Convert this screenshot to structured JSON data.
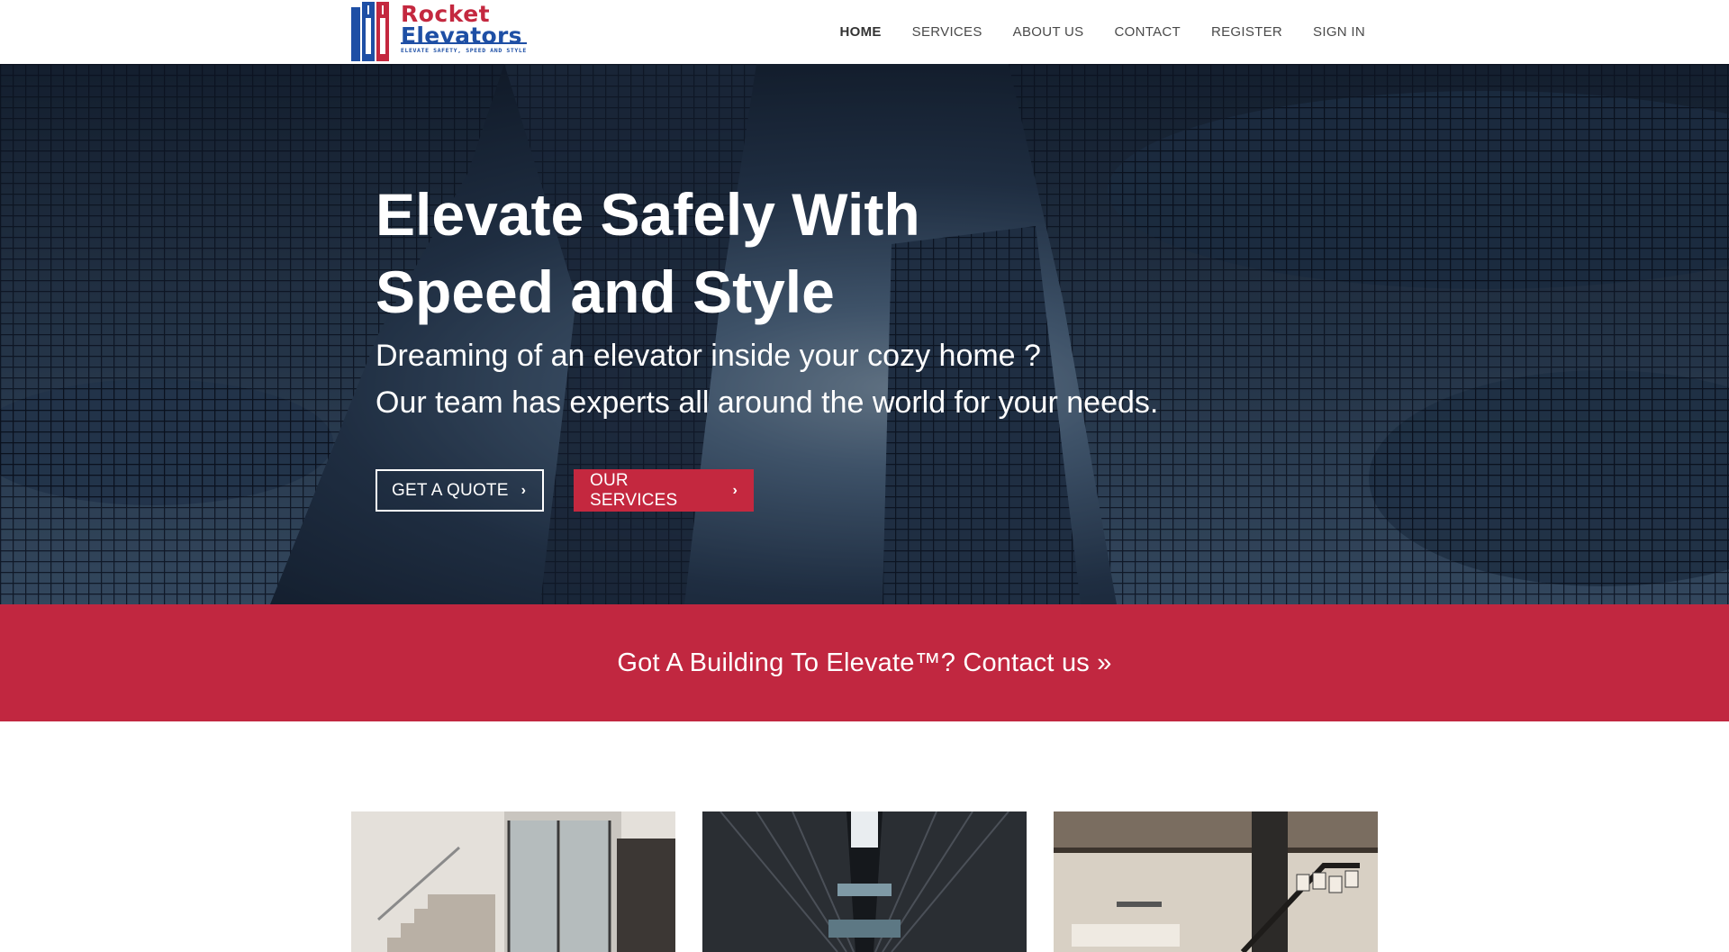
{
  "brand": {
    "word1": "Rocket",
    "word2": "Elevators",
    "tagline": "ELEVATE SAFETY, SPEED AND STYLE",
    "colors": {
      "red": "#c4283f",
      "blue": "#1e4fa5"
    }
  },
  "nav": {
    "items": [
      {
        "label": "HOME",
        "active": true
      },
      {
        "label": "SERVICES",
        "active": false
      },
      {
        "label": "ABOUT US",
        "active": false
      },
      {
        "label": "CONTACT",
        "active": false
      },
      {
        "label": "REGISTER",
        "active": false
      },
      {
        "label": "SIGN IN",
        "active": false
      }
    ]
  },
  "hero": {
    "title_line1": "Elevate Safely With",
    "title_line2": "Speed and Style",
    "subtitle_line1": "Dreaming of an elevator inside your cozy home ?",
    "subtitle_line2": "Our team has experts all around the world for your needs.",
    "quote_button": "GET A QUOTE",
    "services_button": "OUR SERVICES",
    "chevron_icon": "chevron-right-icon"
  },
  "cta": {
    "text": "Got A Building To Elevate™? Contact us »",
    "background": "#c12740"
  }
}
